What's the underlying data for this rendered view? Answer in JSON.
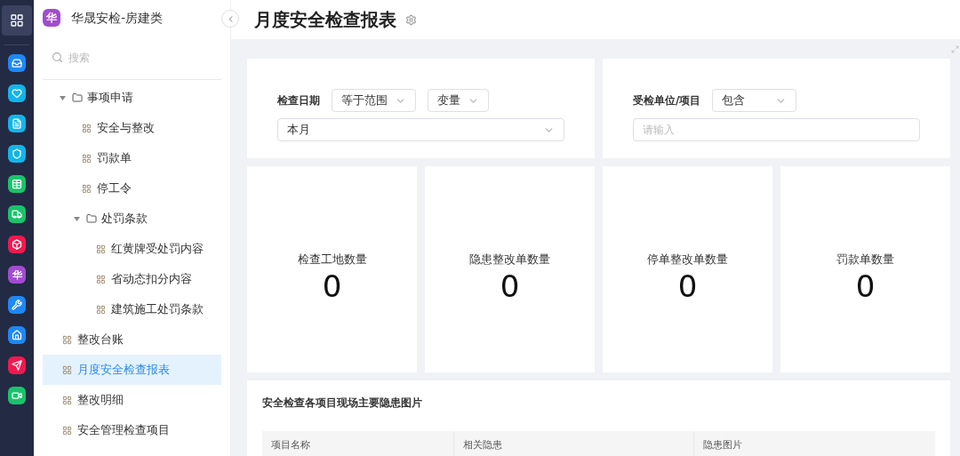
{
  "rail": {
    "apps": [
      {
        "kind": "grid",
        "selected": true,
        "color": "#3a4260"
      },
      {
        "kind": "inbox",
        "selected": false,
        "color": "#1e88f5"
      },
      {
        "kind": "heart",
        "selected": false,
        "color": "#12b5ea"
      },
      {
        "kind": "doc",
        "selected": false,
        "color": "#12b5ea"
      },
      {
        "kind": "shield",
        "selected": false,
        "color": "#12b5ea"
      },
      {
        "kind": "table",
        "selected": false,
        "color": "#19c36b"
      },
      {
        "kind": "truck",
        "selected": false,
        "color": "#19c36b"
      },
      {
        "kind": "cube",
        "selected": false,
        "color": "#f0194f"
      },
      {
        "kind": "letter",
        "label": "华",
        "selected": false,
        "color": "#a24ccf"
      },
      {
        "kind": "wrench",
        "selected": false,
        "color": "#1e88f5"
      },
      {
        "kind": "home",
        "selected": false,
        "color": "#1e88f5"
      },
      {
        "kind": "send",
        "selected": false,
        "color": "#f0194f"
      },
      {
        "kind": "video",
        "selected": false,
        "color": "#19c36b"
      }
    ]
  },
  "sidebar": {
    "logo": "华",
    "title": "华晟安检-房建类",
    "search": {
      "placeholder": "搜索"
    },
    "tree": [
      {
        "kind": "folder",
        "label": "事项申请",
        "expanded": true,
        "children": [
          {
            "kind": "page",
            "label": "安全与整改",
            "selected": false
          },
          {
            "kind": "page",
            "label": "罚款单",
            "selected": false
          },
          {
            "kind": "page",
            "label": "停工令",
            "selected": false
          },
          {
            "kind": "folder",
            "label": "处罚条款",
            "expanded": true,
            "children": [
              {
                "kind": "page",
                "label": "红黄牌受处罚内容",
                "selected": false
              },
              {
                "kind": "page",
                "label": "省动态扣分内容",
                "selected": false
              },
              {
                "kind": "page",
                "label": "建筑施工处罚条款",
                "selected": false
              }
            ]
          }
        ]
      },
      {
        "kind": "page",
        "label": "整改台账",
        "selected": false
      },
      {
        "kind": "page",
        "label": "月度安全检查报表",
        "selected": true
      },
      {
        "kind": "page",
        "label": "整改明细",
        "selected": false
      },
      {
        "kind": "page",
        "label": "安全管理检查项目",
        "selected": false
      }
    ]
  },
  "page": {
    "title": "月度安全检查报表",
    "filters": [
      {
        "label": "检查日期",
        "selects": [
          "等于范围",
          "变量"
        ],
        "value_select": "本月"
      },
      {
        "label": "受检单位/项目",
        "selects": [
          "包含"
        ],
        "input": {
          "placeholder": "请输入"
        }
      }
    ],
    "stats": [
      {
        "label": "检查工地数量",
        "value": "0"
      },
      {
        "label": "隐患整改单数量",
        "value": "0"
      },
      {
        "label": "停单整改单数量",
        "value": "0"
      },
      {
        "label": "罚款单数量",
        "value": "0"
      }
    ],
    "table": {
      "title": "安全检查各项目现场主要隐患图片",
      "columns": [
        "项目名称",
        "相关隐患",
        "隐患图片"
      ]
    }
  }
}
